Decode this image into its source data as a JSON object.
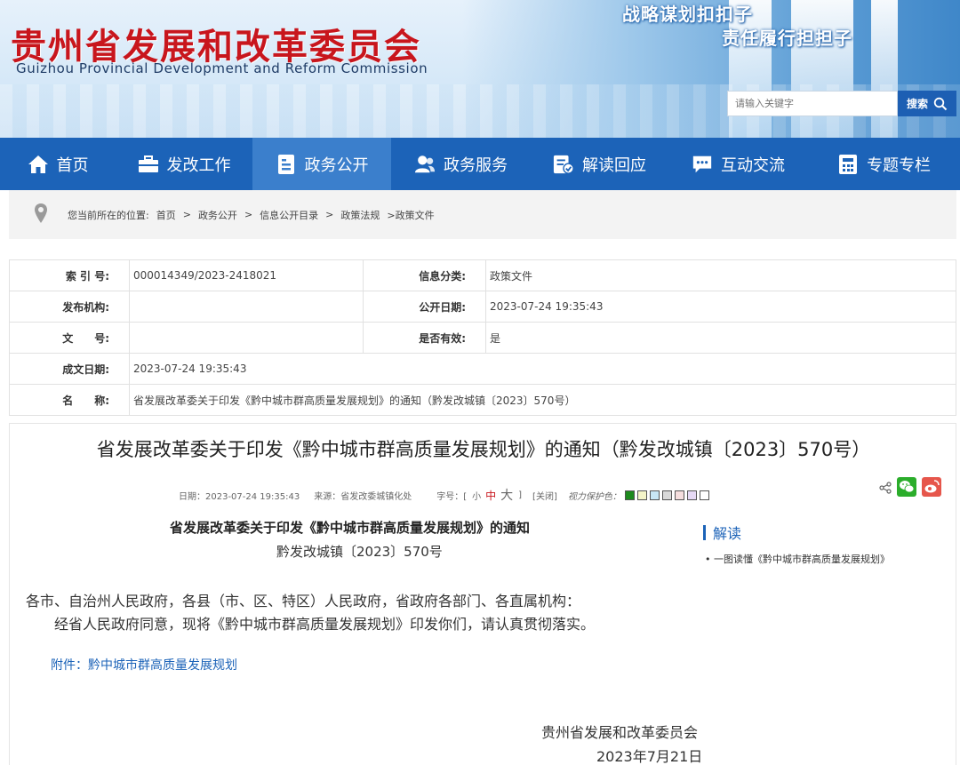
{
  "header": {
    "site_title": "贵州省发展和改革委员会",
    "site_subtitle": "Guizhou Provincial Development and Reform Commission",
    "slogan_line1": "战略谋划扣扣子",
    "slogan_line2": "责任履行担担子",
    "search": {
      "placeholder": "请输入关键字",
      "button_label": "搜索"
    }
  },
  "nav": {
    "items": [
      {
        "label": "首页",
        "icon": "home-icon"
      },
      {
        "label": "发改工作",
        "icon": "briefcase-icon"
      },
      {
        "label": "政务公开",
        "icon": "document-icon",
        "active": true
      },
      {
        "label": "政务服务",
        "icon": "users-icon"
      },
      {
        "label": "解读回应",
        "icon": "form-check-icon"
      },
      {
        "label": "互动交流",
        "icon": "chat-icon"
      },
      {
        "label": "专题专栏",
        "icon": "calculator-icon"
      }
    ]
  },
  "breadcrumb": {
    "prefix": "您当前所在的位置:",
    "items": [
      "首页",
      "政务公开",
      "信息公开目录",
      "政策法规",
      ">政策文件"
    ]
  },
  "info": {
    "index_label": "索 引 号:",
    "index_value": "000014349/2023-2418021",
    "category_label": "信息分类:",
    "category_value": "政策文件",
    "publisher_label": "发布机构:",
    "publisher_value": "",
    "publish_date_label": "公开日期:",
    "publish_date_value": "2023-07-24 19:35:43",
    "doc_no_label": "文　　号:",
    "doc_no_value": "",
    "valid_label": "是否有效:",
    "valid_value": "是",
    "written_date_label": "成文日期:",
    "written_date_value": "2023-07-24 19:35:43",
    "name_label": "名　　称:",
    "name_value": "省发展改革委关于印发《黔中城市群高质量发展规划》的通知（黔发改城镇〔2023〕570号）"
  },
  "article": {
    "title": "省发展改革委关于印发《黔中城市群高质量发展规划》的通知（黔发改城镇〔2023〕570号）",
    "meta": {
      "date": "日期：2023-07-24 19:35:43",
      "source": "来源：省发改委城镇化处",
      "font_label": "字号：[",
      "font_small": "小",
      "font_medium": "中",
      "font_large": "大",
      "font_close": "]",
      "close_label": "[关闭]",
      "eye_label": "视力保护色：",
      "swatch_colors": [
        "#1d8a1d",
        "#f5f5c8",
        "#c8e6f5",
        "#d9d9d9",
        "#f5dede",
        "#e6d9f5",
        "#ffffff"
      ]
    },
    "doc_title": "省发展改革委关于印发《黔中城市群高质量发展规划》的通知",
    "doc_number": "黔发改城镇〔2023〕570号",
    "body_p1": "各市、自治州人民政府，各县（市、区、特区）人民政府，省政府各部门、各直属机构：",
    "body_p2": "经省人民政府同意，现将《黔中城市群高质量发展规划》印发你们，请认真贯彻落实。",
    "attachment": "附件：黔中城市群高质量发展规划",
    "sign_org": "贵州省发展和改革委员会",
    "sign_date": "2023年7月21日"
  },
  "sidebar": {
    "title": "解读",
    "items": [
      "一图读懂《黔中城市群高质量发展规划》"
    ]
  },
  "colors": {
    "nav_bg": "#1c63b8",
    "nav_active": "#3b7fcc",
    "title_red": "#c8161d",
    "link_blue": "#1c63b8"
  }
}
